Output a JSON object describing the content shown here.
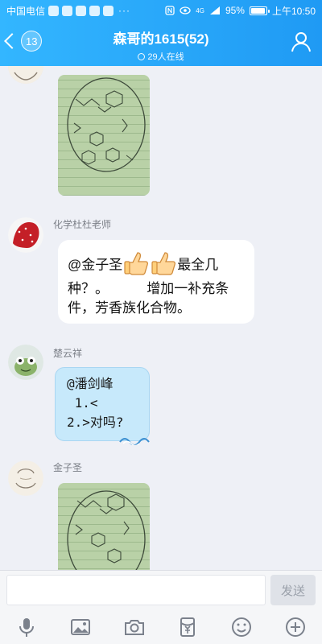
{
  "status_bar": {
    "carrier": "中国电信",
    "more": "···",
    "network": "4G",
    "battery": "95%",
    "battery_level": 0.95,
    "time": "上午10:50"
  },
  "header": {
    "back_count": "13",
    "title": "森哥的1615(52)",
    "online": "29人在线"
  },
  "messages": [
    {
      "type": "image",
      "sender": ""
    },
    {
      "type": "text",
      "sender": "化学杜杜老师",
      "line1_prefix": "@金子圣",
      "line1_suffix": "最全几",
      "line2": "种？。          增加一补充条",
      "line3": "件，芳香族化合物。"
    },
    {
      "type": "styled_text",
      "sender": "楚云祥",
      "lines": [
        "@潘剑峰",
        " 1.<",
        "2.>对吗?"
      ]
    },
    {
      "type": "image",
      "sender": "金子圣"
    }
  ],
  "input": {
    "value": "",
    "send_label": "发送"
  },
  "colors": {
    "header_start": "#33b6ff",
    "header_end": "#1f9af4",
    "chat_bg": "#eef0f6",
    "bubble_blue": "#c7e9fb"
  },
  "toolbar_icons": [
    "microphone-icon",
    "image-icon",
    "camera-icon",
    "red-packet-icon",
    "emoji-icon",
    "plus-icon"
  ]
}
